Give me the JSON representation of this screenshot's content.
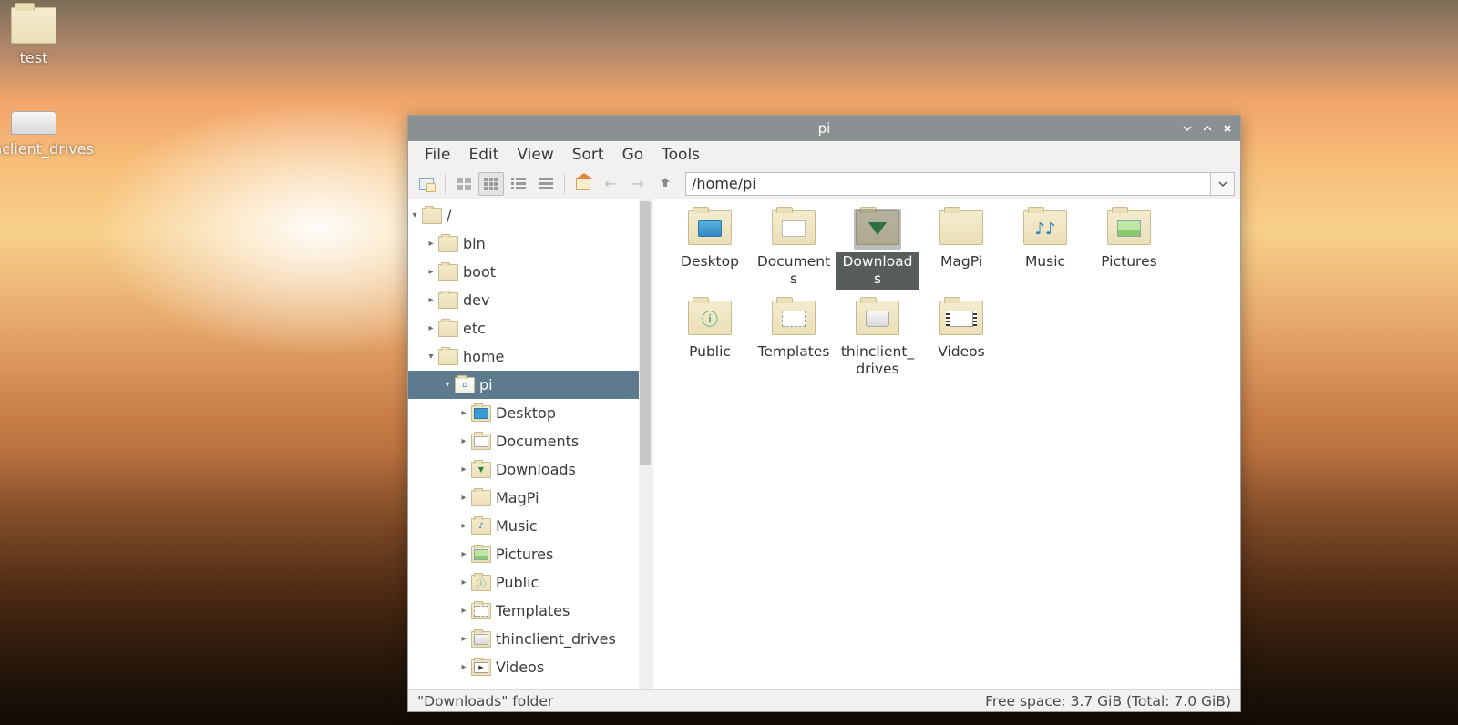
{
  "desktop_icons": [
    {
      "name": "test",
      "kind": "folder"
    },
    {
      "name": "thinclient_drives",
      "kind": "drive"
    }
  ],
  "window": {
    "title": "pi",
    "menubar": [
      "File",
      "Edit",
      "View",
      "Sort",
      "Go",
      "Tools"
    ],
    "path": "/home/pi",
    "status_left": "\"Downloads\" folder",
    "status_right": "Free space: 3.7 GiB (Total: 7.0 GiB)"
  },
  "tree": [
    {
      "level": 0,
      "label": "/",
      "arrow": "down"
    },
    {
      "level": 1,
      "label": "bin",
      "arrow": "right"
    },
    {
      "level": 1,
      "label": "boot",
      "arrow": "right"
    },
    {
      "level": 1,
      "label": "dev",
      "arrow": "right"
    },
    {
      "level": 1,
      "label": "etc",
      "arrow": "right"
    },
    {
      "level": 1,
      "label": "home",
      "arrow": "down"
    },
    {
      "level": 2,
      "label": "pi",
      "arrow": "down",
      "selected": true,
      "icon": "home"
    },
    {
      "level": 3,
      "label": "Desktop",
      "arrow": "right",
      "icon": "desktop"
    },
    {
      "level": 3,
      "label": "Documents",
      "arrow": "right",
      "icon": "doc"
    },
    {
      "level": 3,
      "label": "Downloads",
      "arrow": "right",
      "icon": "down"
    },
    {
      "level": 3,
      "label": "MagPi",
      "arrow": "right"
    },
    {
      "level": 3,
      "label": "Music",
      "arrow": "right",
      "icon": "music"
    },
    {
      "level": 3,
      "label": "Pictures",
      "arrow": "right",
      "icon": "pic"
    },
    {
      "level": 3,
      "label": "Public",
      "arrow": "right",
      "icon": "pub"
    },
    {
      "level": 3,
      "label": "Templates",
      "arrow": "right",
      "icon": "tpl"
    },
    {
      "level": 3,
      "label": "thinclient_drives",
      "arrow": "right",
      "icon": "drv"
    },
    {
      "level": 3,
      "label": "Videos",
      "arrow": "right",
      "icon": "vid"
    }
  ],
  "content": [
    {
      "label": "Desktop",
      "icon": "desktop"
    },
    {
      "label": "Documents",
      "icon": "doc"
    },
    {
      "label": "Downloads",
      "icon": "down",
      "selected": true
    },
    {
      "label": "MagPi",
      "icon": "plain"
    },
    {
      "label": "Music",
      "icon": "music"
    },
    {
      "label": "Pictures",
      "icon": "pic"
    },
    {
      "label": "Public",
      "icon": "pub"
    },
    {
      "label": "Templates",
      "icon": "tpl"
    },
    {
      "label": "thinclient_drives",
      "icon": "drv"
    },
    {
      "label": "Videos",
      "icon": "vid"
    }
  ]
}
